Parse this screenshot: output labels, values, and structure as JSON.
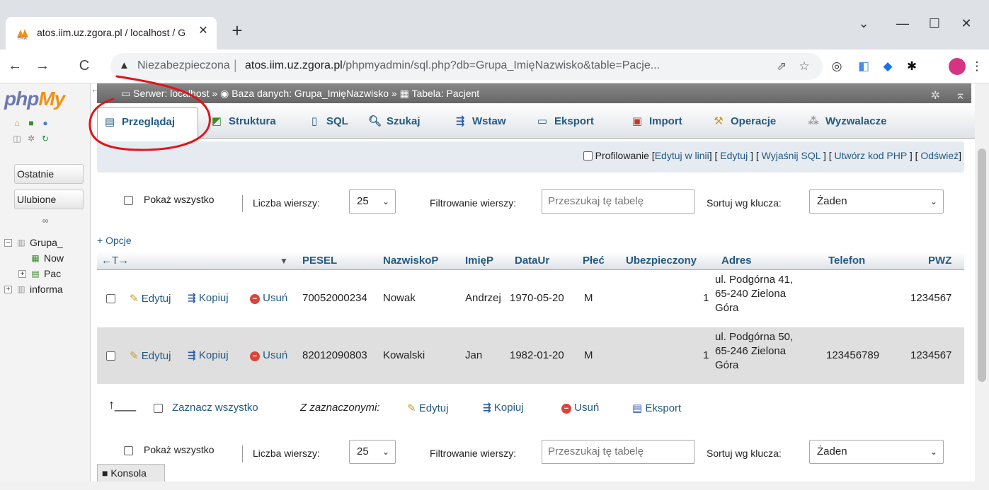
{
  "browser": {
    "tab_title": "atos.iim.uz.zgora.pl / localhost / G",
    "omnibox": {
      "security_label": "Niezabezpieczona",
      "url_host": "atos.iim.uz.zgora.pl",
      "url_path": "/phpmyadmin/sql.php?db=Grupa_ImięNazwisko&table=Pacje..."
    }
  },
  "sidebar": {
    "logo_php": "php",
    "logo_my": "My",
    "recent_label": "Ostatnie",
    "favorites_label": "Ulubione",
    "tree": [
      {
        "label": "Grupa_"
      },
      {
        "label": "Now"
      },
      {
        "label": "Pac"
      },
      {
        "label": "informa"
      }
    ]
  },
  "breadcrumb": {
    "server": "Serwer: localhost",
    "database": "Baza danych: Grupa_ImięNazwisko",
    "table": "Tabela: Pacjent",
    "sep": "»"
  },
  "tabs": [
    {
      "label": "Przeglądaj",
      "icon": "browse-icon",
      "active": true
    },
    {
      "label": "Struktura",
      "icon": "structure-icon"
    },
    {
      "label": "SQL",
      "icon": "sql-icon"
    },
    {
      "label": "Szukaj",
      "icon": "search-icon"
    },
    {
      "label": "Wstaw",
      "icon": "insert-icon"
    },
    {
      "label": "Eksport",
      "icon": "export-icon"
    },
    {
      "label": "Import",
      "icon": "import-icon"
    },
    {
      "label": "Operacje",
      "icon": "wrench-icon"
    },
    {
      "label": "Wyzwalacze",
      "icon": "triggers-icon"
    }
  ],
  "profiling": {
    "label": "Profilowanie",
    "links": [
      "Edytuj w linii",
      "Edytuj",
      "Wyjaśnij SQL",
      "Utwórz kod PHP",
      "Odśwież"
    ]
  },
  "nav_controls": {
    "show_all": "Pokaż wszystko",
    "rows_label": "Liczba wierszy:",
    "rows_value": "25",
    "filter_label": "Filtrowanie wierszy:",
    "filter_placeholder": "Przeszukaj tę tabelę",
    "sort_label": "Sortuj wg klucza:",
    "sort_value": "Żaden"
  },
  "options_link": "+ Opcje",
  "columns": [
    "PESEL",
    "NazwiskoP",
    "ImięP",
    "DataUr",
    "Płeć",
    "Ubezpieczony",
    "Adres",
    "Telefon",
    "PWZ"
  ],
  "row_actions": {
    "edit": "Edytuj",
    "copy": "Kopiuj",
    "delete": "Usuń"
  },
  "rows": [
    {
      "PESEL": "70052000234",
      "NazwiskoP": "Nowak",
      "ImieP": "Andrzej",
      "DataUr": "1970-05-20",
      "Plec": "M",
      "Ubezpieczony": "1",
      "Adres": "ul. Podgórna 41,\n65-240 Zielona\nGóra",
      "Telefon": "",
      "PWZ": "1234567"
    },
    {
      "PESEL": "82012090803",
      "NazwiskoP": "Kowalski",
      "ImieP": "Jan",
      "DataUr": "1982-01-20",
      "Plec": "M",
      "Ubezpieczony": "1",
      "Adres": "ul. Podgórna 50,\n65-246 Zielona\nGóra",
      "Telefon": "123456789",
      "PWZ": "1234567"
    }
  ],
  "bulk": {
    "check_all": "Zaznacz wszystko",
    "with_selected": "Z zaznaczonymi:",
    "edit": "Edytuj",
    "copy": "Kopiuj",
    "delete": "Usuń",
    "export": "Eksport"
  },
  "console_label": "Konsola",
  "colors": {
    "link": "#235a81",
    "annotation": "#e0141a",
    "breadcrumb_bg": "#777777",
    "row_alt": "#dfdfdf"
  }
}
